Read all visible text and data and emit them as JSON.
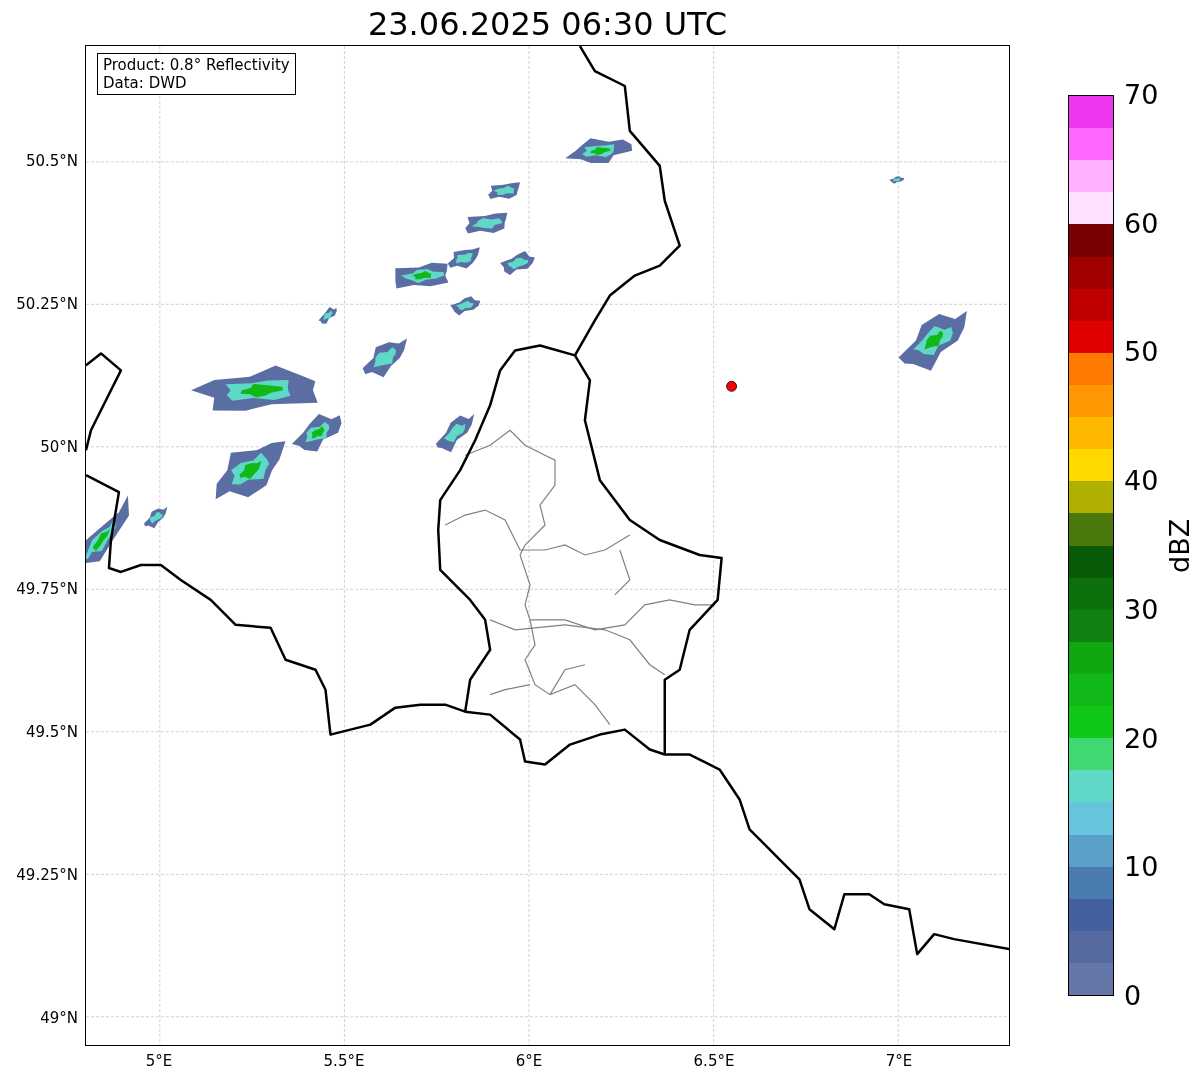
{
  "title": "23.06.2025 06:30 UTC",
  "info_box": [
    "Product: 0.8° Reflectivity",
    "Data: DWD"
  ],
  "map": {
    "y_ticks": [
      "50.5°N",
      "50.25°N",
      "50°N",
      "49.75°N",
      "49.5°N",
      "49.25°N",
      "49°N"
    ],
    "x_ticks": [
      "5°E",
      "5.5°E",
      "6°E",
      "6.5°E",
      "7°E"
    ]
  },
  "colorbar": {
    "label": "dBZ",
    "ticks": [
      "70",
      "60",
      "50",
      "40",
      "30",
      "20",
      "10",
      "0"
    ]
  }
}
